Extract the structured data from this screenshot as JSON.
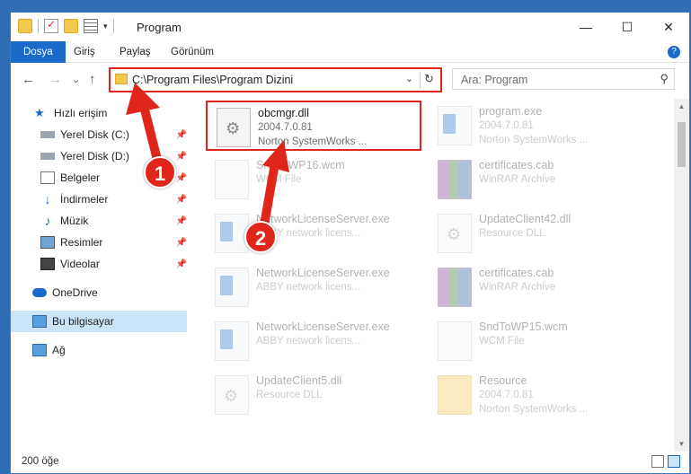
{
  "window": {
    "title": "Program"
  },
  "window_buttons": {
    "minimize": "—",
    "maximize": "☐",
    "close": "✕"
  },
  "ribbon": {
    "tabs": [
      "Dosya",
      "Giriş",
      "Paylaş",
      "Görünüm"
    ],
    "help": "?"
  },
  "address": {
    "path": "C:\\Program Files\\Program Dizini",
    "dropdown": "⌄",
    "refresh": "↻"
  },
  "search": {
    "placeholder": "Ara: Program"
  },
  "nav_icons": {
    "back": "←",
    "forward": "→",
    "recent": "⌄",
    "up": "↑"
  },
  "sidebar": {
    "items": [
      {
        "label": "Hızlı erişim",
        "icon": "star-icon",
        "pinned": false
      },
      {
        "label": "Yerel Disk (C:)",
        "icon": "drive-icon",
        "pinned": true
      },
      {
        "label": "Yerel Disk (D:)",
        "icon": "drive-icon",
        "pinned": true
      },
      {
        "label": "Belgeler",
        "icon": "documents-icon",
        "pinned": true
      },
      {
        "label": "İndirmeler",
        "icon": "download-icon",
        "pinned": true
      },
      {
        "label": "Müzik",
        "icon": "music-icon",
        "pinned": true
      },
      {
        "label": "Resimler",
        "icon": "pictures-icon",
        "pinned": true
      },
      {
        "label": "Videolar",
        "icon": "video-icon",
        "pinned": true
      },
      {
        "label": "OneDrive",
        "icon": "cloud-icon",
        "pinned": false
      },
      {
        "label": "Bu bilgisayar",
        "icon": "computer-icon",
        "pinned": false,
        "selected": true
      },
      {
        "label": "Ağ",
        "icon": "network-icon",
        "pinned": false
      }
    ]
  },
  "files": [
    {
      "name": "obcmgr.dll",
      "meta1": "2004.7.0.81",
      "meta2": "Norton SystemWorks ...",
      "type": "dll",
      "highlighted": true
    },
    {
      "name": "program.exe",
      "meta1": "2004.7.0.81",
      "meta2": "Norton SystemWorks ...",
      "type": "exe"
    },
    {
      "name": "SndToWP16.wcm",
      "meta1": "WCM File",
      "meta2": "",
      "type": "blank"
    },
    {
      "name": "certificates.cab",
      "meta1": "WinRAR Archive",
      "meta2": "",
      "type": "cab"
    },
    {
      "name": "NetworkLicenseServer.exe",
      "meta1": "ABBY network licens...",
      "meta2": "",
      "type": "exe"
    },
    {
      "name": "UpdateClient42.dll",
      "meta1": "Resource DLL",
      "meta2": "",
      "type": "dll"
    },
    {
      "name": "NetworkLicenseServer.exe",
      "meta1": "ABBY network licens...",
      "meta2": "",
      "type": "exe"
    },
    {
      "name": "certificates.cab",
      "meta1": "WinRAR Archive",
      "meta2": "",
      "type": "cab"
    },
    {
      "name": "NetworkLicenseServer.exe",
      "meta1": "ABBY network licens...",
      "meta2": "",
      "type": "exe"
    },
    {
      "name": "SndToWP15.wcm",
      "meta1": "WCM File",
      "meta2": "",
      "type": "blank"
    },
    {
      "name": "UpdateClient5.dll",
      "meta1": "Resource DLL",
      "meta2": "",
      "type": "dll"
    },
    {
      "name": "Resource",
      "meta1": "2004.7.0.81",
      "meta2": "Norton SystemWorks ...",
      "type": "folder"
    }
  ],
  "status": {
    "count": "200 öğe"
  },
  "annotations": {
    "step1": "1",
    "step2": "2"
  },
  "colors": {
    "accent": "#1b6ac9",
    "highlight": "#e0261a",
    "selected": "#cce4f7"
  }
}
